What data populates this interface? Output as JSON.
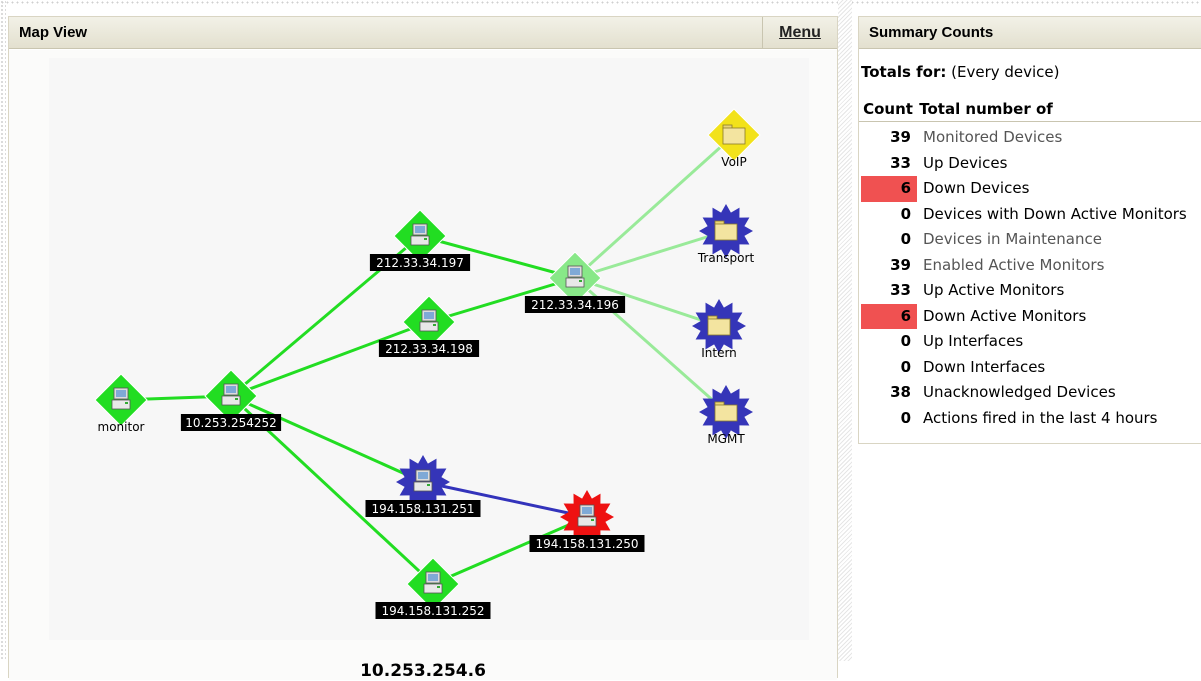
{
  "map_panel": {
    "title": "Map View",
    "menu_label": "Menu",
    "caption": "10.253.254.6",
    "nodes": [
      {
        "id": "monitor",
        "label": "monitor",
        "shape": "diamond",
        "color": "#22dd22",
        "icon": "computer-icon"
      },
      {
        "id": "n252",
        "label": "10.253.254252",
        "shape": "diamond",
        "color": "#22dd22",
        "icon": "computer-icon"
      },
      {
        "id": "n197",
        "label": "212.33.34.197",
        "shape": "diamond",
        "color": "#22dd22",
        "icon": "computer-icon"
      },
      {
        "id": "n198",
        "label": "212.33.34.198",
        "shape": "diamond",
        "color": "#22dd22",
        "icon": "computer-icon"
      },
      {
        "id": "n196",
        "label": "212.33.34.196",
        "shape": "diamond",
        "color": "#88e888",
        "icon": "computer-icon"
      },
      {
        "id": "voip",
        "label": "VoIP",
        "shape": "diamond",
        "color": "#f2e21a",
        "icon": "folder-icon"
      },
      {
        "id": "transport",
        "label": "Transport",
        "shape": "star",
        "color": "#3535b8",
        "icon": "folder-icon"
      },
      {
        "id": "intern",
        "label": "Intern",
        "shape": "star",
        "color": "#3535b8",
        "icon": "folder-icon"
      },
      {
        "id": "mgmt",
        "label": "MGMT",
        "shape": "star",
        "color": "#3535b8",
        "icon": "folder-icon"
      },
      {
        "id": "n251",
        "label": "194.158.131.251",
        "shape": "star",
        "color": "#3535b8",
        "icon": "computer-icon"
      },
      {
        "id": "n250",
        "label": "194.158.131.250",
        "shape": "star",
        "color": "#ee1111",
        "icon": "computer-icon"
      },
      {
        "id": "n252b",
        "label": "194.158.131.252",
        "shape": "diamond",
        "color": "#22dd22",
        "icon": "computer-icon"
      }
    ],
    "links": [
      {
        "from": "monitor",
        "to": "n252",
        "color": "#22dd22"
      },
      {
        "from": "n252",
        "to": "n197",
        "color": "#22dd22"
      },
      {
        "from": "n252",
        "to": "n198",
        "color": "#22dd22"
      },
      {
        "from": "n252",
        "to": "n251",
        "color": "#22dd22"
      },
      {
        "from": "n252",
        "to": "n252b",
        "color": "#22dd22"
      },
      {
        "from": "n197",
        "to": "n196",
        "color": "#22dd22"
      },
      {
        "from": "n198",
        "to": "n196",
        "color": "#22dd22"
      },
      {
        "from": "n196",
        "to": "voip",
        "color": "#99ea99"
      },
      {
        "from": "n196",
        "to": "transport",
        "color": "#99ea99"
      },
      {
        "from": "n196",
        "to": "intern",
        "color": "#99ea99"
      },
      {
        "from": "n196",
        "to": "mgmt",
        "color": "#99ea99"
      },
      {
        "from": "n251",
        "to": "n250",
        "color": "#3333bb"
      },
      {
        "from": "n252b",
        "to": "n250",
        "color": "#22dd22"
      }
    ]
  },
  "summary": {
    "title": "Summary Counts",
    "totals_label": "Totals for:",
    "totals_value": "(Every device)",
    "col_count": "Count",
    "col_total": "Total number of",
    "alert_color": "#f05151",
    "rows": [
      {
        "count": "39",
        "label": "Monitored Devices",
        "alert": false,
        "gray": true
      },
      {
        "count": "33",
        "label": "Up Devices",
        "alert": false,
        "gray": false
      },
      {
        "count": "6",
        "label": "Down Devices",
        "alert": true,
        "gray": false
      },
      {
        "count": "0",
        "label": "Devices with Down Active Monitors",
        "alert": false,
        "gray": false
      },
      {
        "count": "0",
        "label": "Devices in Maintenance",
        "alert": false,
        "gray": true
      },
      {
        "count": "39",
        "label": "Enabled Active Monitors",
        "alert": false,
        "gray": true
      },
      {
        "count": "33",
        "label": "Up Active Monitors",
        "alert": false,
        "gray": false
      },
      {
        "count": "6",
        "label": "Down Active Monitors",
        "alert": true,
        "gray": false
      },
      {
        "count": "0",
        "label": "Up Interfaces",
        "alert": false,
        "gray": false
      },
      {
        "count": "0",
        "label": "Down Interfaces",
        "alert": false,
        "gray": false
      },
      {
        "count": "38",
        "label": "Unacknowledged Devices",
        "alert": false,
        "gray": false
      },
      {
        "count": "0",
        "label": "Actions fired in the last 4 hours",
        "alert": false,
        "gray": false
      }
    ]
  }
}
